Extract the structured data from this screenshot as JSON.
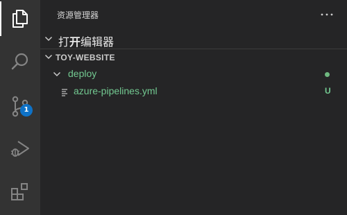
{
  "activity_bar": {
    "items": [
      {
        "name": "explorer",
        "icon": "files-icon"
      },
      {
        "name": "search",
        "icon": "search-icon"
      },
      {
        "name": "source-control",
        "icon": "source-control-icon",
        "badge": "1"
      },
      {
        "name": "run-and-debug",
        "icon": "debug-icon"
      },
      {
        "name": "extensions",
        "icon": "extensions-icon"
      }
    ]
  },
  "sidebar": {
    "title": "资源管理器",
    "more_actions": "···",
    "open_editors": {
      "label_pre": "打",
      "label_bold": "开",
      "label_post": "编辑器"
    },
    "workspace": {
      "name": "TOY-WEBSITE",
      "folder": {
        "name": "deploy",
        "status_dot_color": "#6fb980"
      },
      "file": {
        "name": "azure-pipelines.yml",
        "git_status": "U"
      }
    }
  },
  "colors": {
    "activity_bg": "#333333",
    "sidebar_bg": "#252526",
    "git_added": "#73c991",
    "badge": "#0e72c7"
  }
}
